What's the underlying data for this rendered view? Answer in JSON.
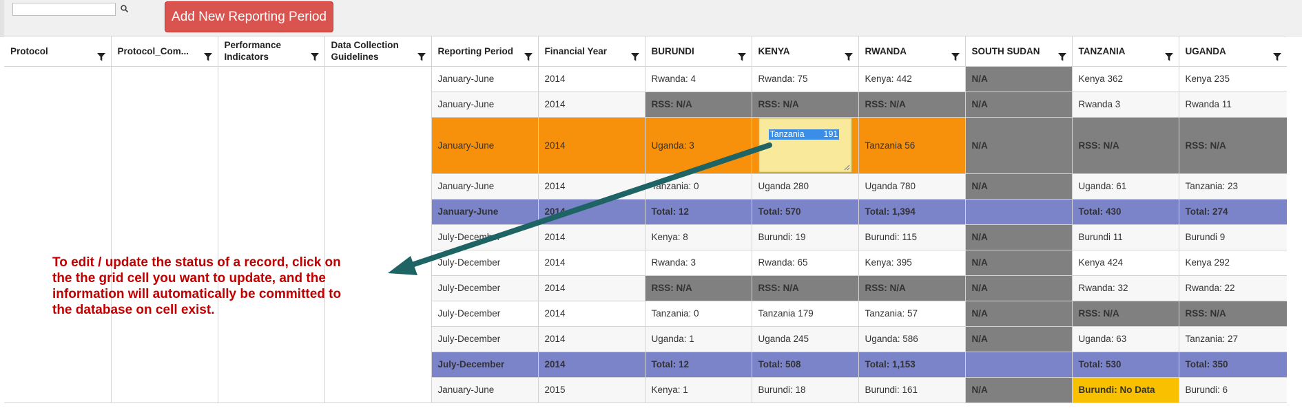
{
  "toolbar": {
    "search_placeholder": "",
    "search_value": "",
    "add_button_label": "Add New Reporting Period"
  },
  "columns": [
    "Protocol",
    "Protocol_Com...",
    "Performance Indicators",
    "Data Collection Guidelines",
    "Reporting Period",
    "Financial Year",
    "BURUNDI",
    "KENYA",
    "RWANDA",
    "SOUTH SUDAN",
    "TANZANIA",
    "UGANDA"
  ],
  "rows": [
    {
      "period": "January-June",
      "year": "2014",
      "burundi": "Rwanda: 4",
      "kenya": "Rwanda: 75",
      "rwanda": "Kenya: 442",
      "south_sudan": "N/A",
      "tanzania": "Kenya 362",
      "uganda": "Kenya 235"
    },
    {
      "period": "January-June",
      "year": "2014",
      "burundi": "RSS: N/A",
      "kenya": "RSS: N/A",
      "rwanda": "RSS: N/A",
      "south_sudan": "N/A",
      "tanzania": "Rwanda 3",
      "uganda": "Rwanda 11"
    },
    {
      "period": "January-June",
      "year": "2014",
      "burundi": "Uganda: 3",
      "kenya": "Tanzania 191",
      "rwanda": "Tanzania 56",
      "south_sudan": "N/A",
      "tanzania": "RSS: N/A",
      "uganda": "RSS: N/A"
    },
    {
      "period": "January-June",
      "year": "2014",
      "burundi": "Tanzania: 0",
      "kenya": "Uganda 280",
      "rwanda": "Uganda 780",
      "south_sudan": "N/A",
      "tanzania": "Uganda: 61",
      "uganda": "Tanzania: 23"
    },
    {
      "period": "January-June",
      "year": "2014",
      "burundi": "Total: 12",
      "kenya": "Total: 570",
      "rwanda": "Total: 1,394",
      "south_sudan": "",
      "tanzania": "Total: 430",
      "uganda": "Total: 274"
    },
    {
      "period": "July-December",
      "year": "2014",
      "burundi": "Kenya: 8",
      "kenya": "Burundi: 19",
      "rwanda": "Burundi: 115",
      "south_sudan": "N/A",
      "tanzania": "Burundi 11",
      "uganda": "Burundi 9"
    },
    {
      "period": "July-December",
      "year": "2014",
      "burundi": "Rwanda: 3",
      "kenya": "Rwanda: 65",
      "rwanda": "Kenya: 395",
      "south_sudan": "N/A",
      "tanzania": "Kenya 424",
      "uganda": "Kenya 292"
    },
    {
      "period": "July-December",
      "year": "2014",
      "burundi": "RSS: N/A",
      "kenya": "RSS: N/A",
      "rwanda": "RSS: N/A",
      "south_sudan": "N/A",
      "tanzania": "Rwanda: 32",
      "uganda": "Rwanda: 22"
    },
    {
      "period": "July-December",
      "year": "2014",
      "burundi": "Tanzania: 0",
      "kenya": "Tanzania 179",
      "rwanda": "Tanzania: 57",
      "south_sudan": "N/A",
      "tanzania": "RSS: N/A",
      "uganda": "RSS: N/A"
    },
    {
      "period": "July-December",
      "year": "2014",
      "burundi": "Uganda: 1",
      "kenya": "Uganda 245",
      "rwanda": "Uganda: 586",
      "south_sudan": "N/A",
      "tanzania": "Uganda: 63",
      "uganda": "Tanzania: 27"
    },
    {
      "period": "July-December",
      "year": "2014",
      "burundi": "Total: 12",
      "kenya": "Total: 508",
      "rwanda": "Total: 1,153",
      "south_sudan": "",
      "tanzania": "Total: 530",
      "uganda": "Total: 350"
    },
    {
      "period": "January-June",
      "year": "2015",
      "burundi": "Kenya: 1",
      "kenya": "Burundi: 18",
      "rwanda": "Burundi: 161",
      "south_sudan": "N/A",
      "tanzania": "Burundi: No Data",
      "uganda": "Burundi: 6"
    }
  ],
  "edit_cell": {
    "label": "Tanzania",
    "value": "191"
  },
  "callout": {
    "lines": [
      "To edit / update the status of a record, click on",
      "the the grid cell you want to update, and the",
      "information will automatically be committed to",
      "the database on cell exist."
    ]
  },
  "colors": {
    "button": "#d9534f",
    "na": "#808080",
    "orange": "#f7900a",
    "total": "#7b83c9",
    "nodata": "#f9c000",
    "callout_text": "#c00000",
    "arrow": "#1f6464"
  },
  "icons": {
    "search": "magnifier-icon",
    "filter": "funnel-icon"
  }
}
